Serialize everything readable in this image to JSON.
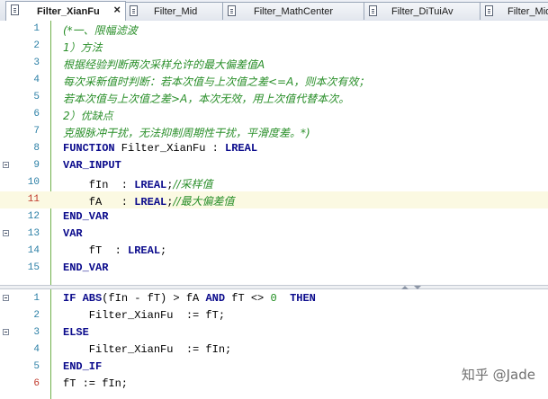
{
  "tabs": [
    {
      "label": "Filter_XianFu",
      "active": true,
      "close": "×"
    },
    {
      "label": "Filter_Mid"
    },
    {
      "label": "Filter_MathCenter"
    },
    {
      "label": "Filter_DiTuiAv"
    },
    {
      "label": "Filter_Mid"
    }
  ],
  "declaration_lines": [
    {
      "n": "1",
      "tokens": [
        {
          "t": "(*一、限幅滤波",
          "c": "comment"
        }
      ]
    },
    {
      "n": "2",
      "tokens": [
        {
          "t": "1）方法",
          "c": "comment"
        }
      ]
    },
    {
      "n": "3",
      "tokens": [
        {
          "t": "根据经验判断两次采样允许的最大偏差值A",
          "c": "comment"
        }
      ]
    },
    {
      "n": "4",
      "tokens": [
        {
          "t": "每次采新值时判断：若本次值与上次值之差<=A，则本次有效；",
          "c": "comment"
        }
      ]
    },
    {
      "n": "5",
      "tokens": [
        {
          "t": "若本次值与上次值之差>A，本次无效，用上次值代替本次。",
          "c": "comment"
        }
      ]
    },
    {
      "n": "6",
      "tokens": [
        {
          "t": "2）优缺点",
          "c": "comment"
        }
      ]
    },
    {
      "n": "7",
      "tokens": [
        {
          "t": "克服脉冲干扰，无法抑制周期性干扰，平滑度差。*)",
          "c": "comment"
        }
      ]
    },
    {
      "n": "8",
      "tokens": [
        {
          "t": "FUNCTION",
          "c": "kw"
        },
        {
          "t": " Filter_XianFu : ",
          "c": ""
        },
        {
          "t": "LREAL",
          "c": "kw"
        }
      ]
    },
    {
      "n": "9",
      "fold": true,
      "tokens": [
        {
          "t": "VAR_INPUT",
          "c": "kw"
        }
      ]
    },
    {
      "n": "10",
      "tokens": [
        {
          "t": "    fIn  : ",
          "c": ""
        },
        {
          "t": "LREAL",
          "c": "kw"
        },
        {
          "t": ";",
          "c": ""
        },
        {
          "t": "//采样值",
          "c": "comment"
        }
      ]
    },
    {
      "n": "11",
      "red": true,
      "highlight": true,
      "tokens": [
        {
          "t": "    fA   : ",
          "c": ""
        },
        {
          "t": "LREAL",
          "c": "kw"
        },
        {
          "t": ";",
          "c": ""
        },
        {
          "t": "//最大偏差值",
          "c": "comment"
        }
      ]
    },
    {
      "n": "12",
      "tokens": [
        {
          "t": "END_VAR",
          "c": "kw"
        }
      ]
    },
    {
      "n": "13",
      "fold": true,
      "tokens": [
        {
          "t": "VAR",
          "c": "kw"
        }
      ]
    },
    {
      "n": "14",
      "tokens": [
        {
          "t": "    fT  : ",
          "c": ""
        },
        {
          "t": "LREAL",
          "c": "kw"
        },
        {
          "t": ";",
          "c": ""
        }
      ]
    },
    {
      "n": "15",
      "tokens": [
        {
          "t": "END_VAR",
          "c": "kw"
        }
      ]
    }
  ],
  "implementation_lines": [
    {
      "n": "1",
      "fold": true,
      "tokens": [
        {
          "t": "IF",
          "c": "kw"
        },
        {
          "t": " ",
          "c": ""
        },
        {
          "t": "ABS",
          "c": "kw"
        },
        {
          "t": "(fIn - fT) > fA ",
          "c": ""
        },
        {
          "t": "AND",
          "c": "kw"
        },
        {
          "t": " fT <> ",
          "c": ""
        },
        {
          "t": "0",
          "c": "num"
        },
        {
          "t": "  ",
          "c": ""
        },
        {
          "t": "THEN",
          "c": "kw"
        }
      ]
    },
    {
      "n": "2",
      "tokens": [
        {
          "t": "    Filter_XianFu  := fT;",
          "c": ""
        }
      ]
    },
    {
      "n": "3",
      "fold": true,
      "tokens": [
        {
          "t": "ELSE",
          "c": "kw"
        }
      ]
    },
    {
      "n": "4",
      "tokens": [
        {
          "t": "    Filter_XianFu  := fIn;",
          "c": ""
        }
      ]
    },
    {
      "n": "5",
      "tokens": [
        {
          "t": "END_IF",
          "c": "kw"
        }
      ]
    },
    {
      "n": "6",
      "red": true,
      "tokens": [
        {
          "t": "fT := fIn;",
          "c": ""
        }
      ]
    }
  ],
  "watermark": "知乎 @Jade",
  "colors": {
    "comment": "#2a8f2a",
    "keyword": "#0b0b8c",
    "gutter_line": "#6fb04a",
    "highlight": "#fbf9e2"
  }
}
